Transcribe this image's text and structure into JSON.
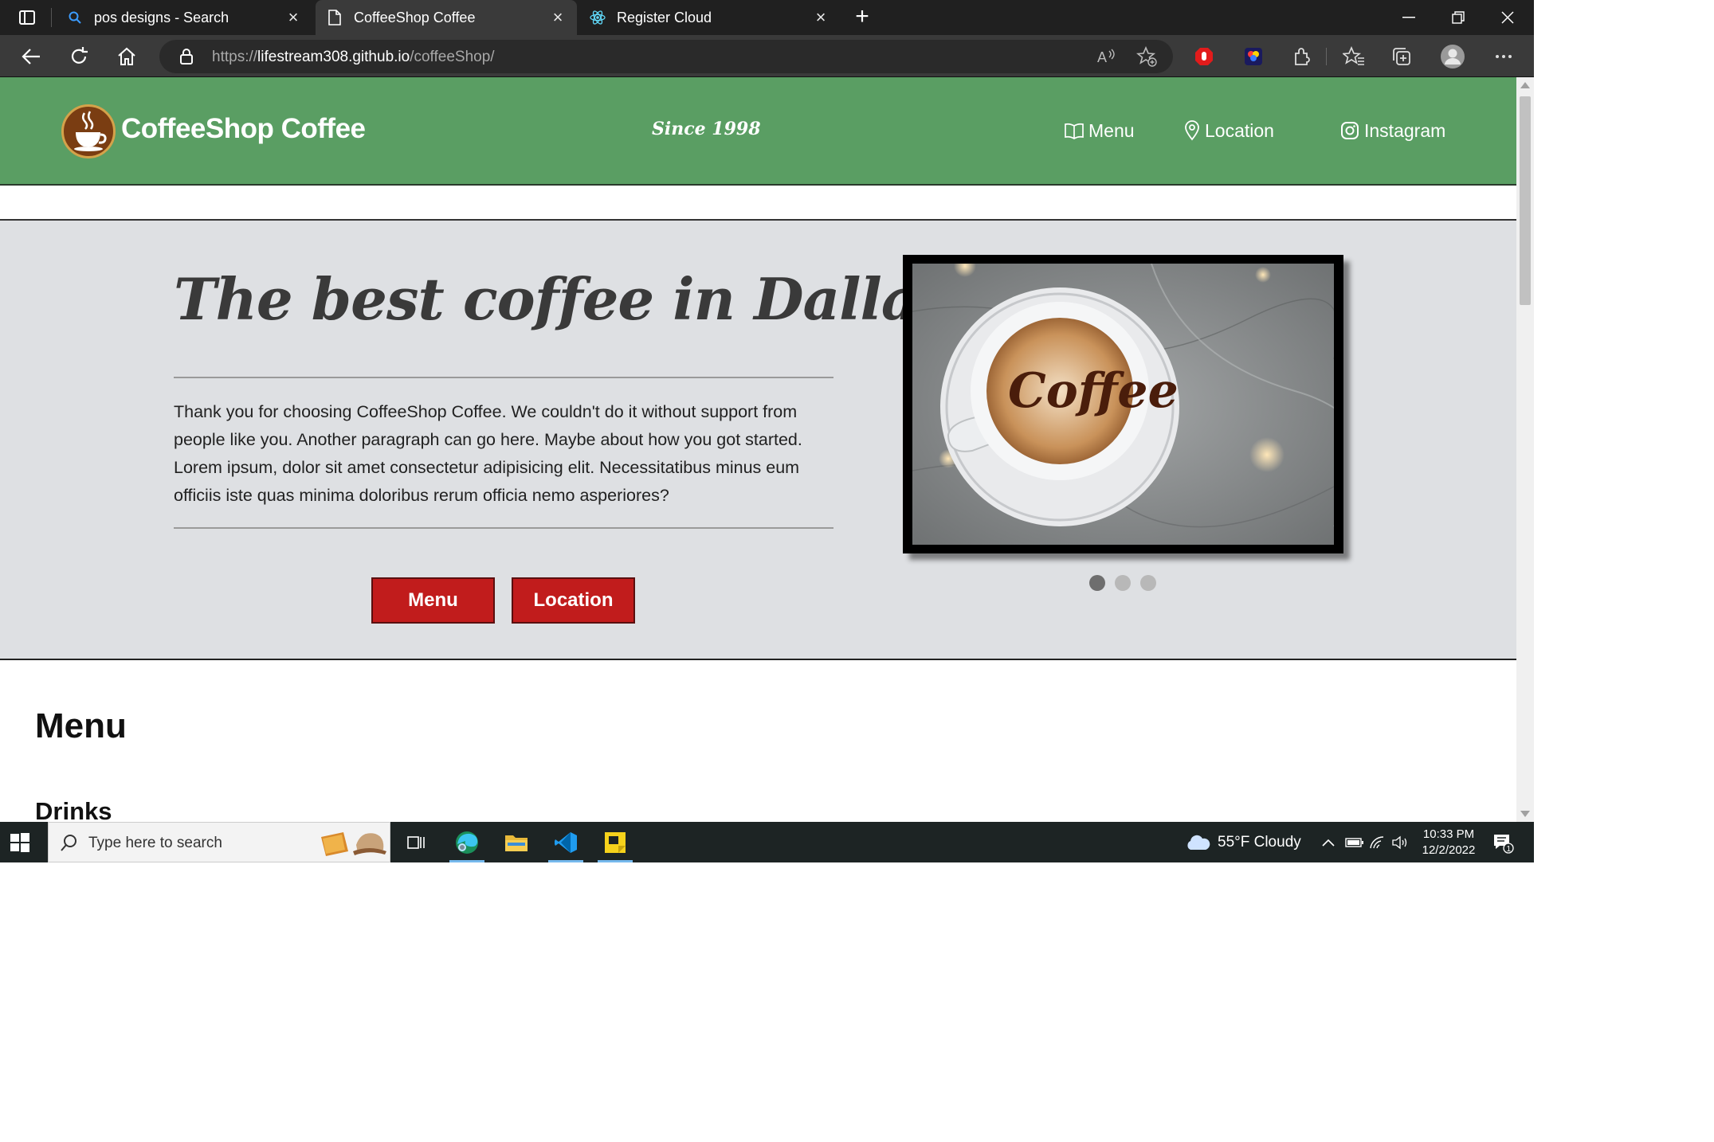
{
  "browser": {
    "tabs": [
      {
        "title": "pos designs - Search"
      },
      {
        "title": "CoffeeShop Coffee"
      },
      {
        "title": "Register Cloud"
      }
    ],
    "url_prefix": "https://",
    "url_host": "lifestream308.github.io",
    "url_path": "/coffeeShop/"
  },
  "site": {
    "brand": "CoffeeShop Coffee",
    "since": "Since 1998",
    "nav": [
      {
        "label": "Menu",
        "icon": "book-icon"
      },
      {
        "label": "Location",
        "icon": "map-pin-icon"
      },
      {
        "label": "Instagram",
        "icon": "instagram-icon"
      }
    ],
    "colors": {
      "header": "#5a9e63",
      "button": "#c11c1c",
      "hero_bg": "#dee0e3"
    }
  },
  "hero": {
    "title": "The best coffee in Dallas",
    "body": "Thank you for choosing CoffeeShop Coffee. We couldn't do it without support from people like you. Another paragraph can go here. Maybe about how you got started. Lorem ipsum, dolor sit amet consectetur adipisicing elit. Necessitatibus minus eum officiis iste quas minima doloribus rerum officia nemo asperiores?",
    "buttons": [
      {
        "label": "Menu"
      },
      {
        "label": "Location"
      }
    ],
    "carousel": {
      "slides": 3,
      "active": 1,
      "image_text": "Coffee"
    }
  },
  "sections": {
    "menu_heading": "Menu",
    "drinks_heading": "Drinks"
  },
  "taskbar": {
    "search_placeholder": "Type here to search",
    "weather": "55°F  Cloudy",
    "time": "10:33 PM",
    "date": "12/2/2022",
    "notifications": "1"
  }
}
